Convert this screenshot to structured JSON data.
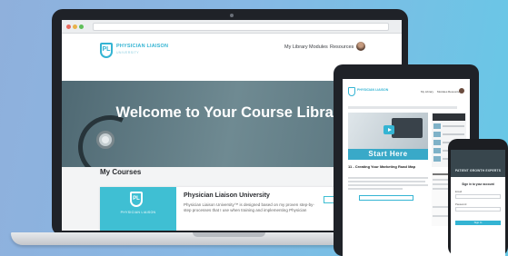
{
  "laptop": {
    "header": {
      "logo_text": "PHYSICIAN LIAISON",
      "logo_sub": "UNIVERSITY",
      "logo_initials": "PL",
      "nav": [
        "My Library",
        "Modules",
        "Resources"
      ]
    },
    "hero": {
      "title": "Welcome to Your Course Library"
    },
    "courses": {
      "section_title": "My Courses",
      "card": {
        "title": "Physician Liaison University",
        "description": "Physician Liaison University™ is designed based on my proven step-by-step processes that I use when training and implementing Physician",
        "logo_initials": "PL",
        "logo_text": "PHYSICIAN LIAISON"
      }
    }
  },
  "tablet": {
    "logo_text": "PHYSICIAN LIAISON",
    "nav": [
      "My Library",
      "Modules",
      "Resources"
    ],
    "video_banner": "Start Here",
    "lesson_title": "11 - Creating Your Marketing Road Map"
  },
  "phone": {
    "brand": "PATIENT GROWTH EXPERTS",
    "form_title": "Sign in to your account",
    "email_label": "Email",
    "password_label": "Password",
    "button_label": "Sign In"
  },
  "colors": {
    "brand": "#34b4d3",
    "background_left": "#8fb0dc",
    "background_right": "#66c8e6"
  }
}
